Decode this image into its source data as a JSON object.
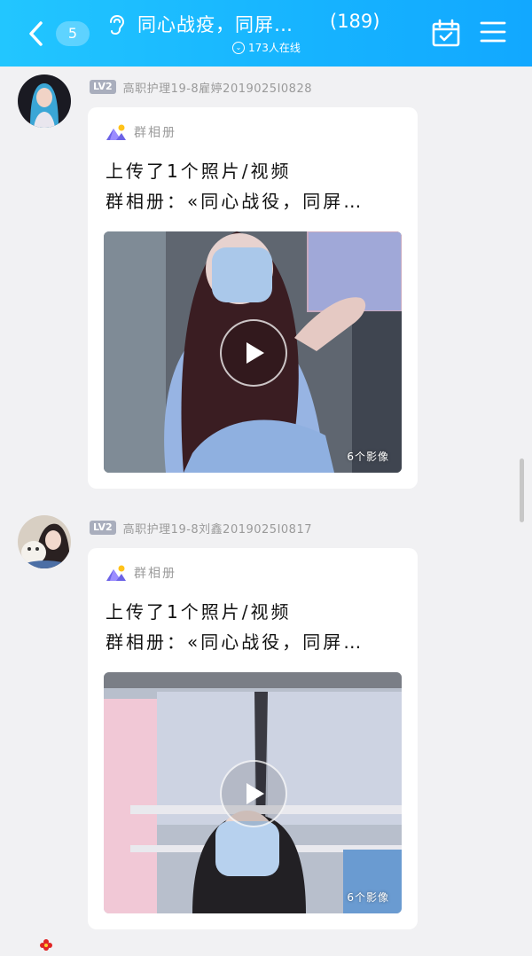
{
  "header": {
    "unread_count": "5",
    "title": "同心战疫，同屏…",
    "member_count": "(189)",
    "online_status": "173人在线",
    "colors": {
      "bar": "#16b3ff",
      "text": "#ffffff"
    }
  },
  "messages": [
    {
      "level": "LV2",
      "sender": "高职护理19-8雇婷2019025I0828",
      "source_label": "群相册",
      "line1": "上传了1个照片/视频",
      "line2": "群相册：«同心战役，同屏…",
      "media_count": "6个影像"
    },
    {
      "level": "LV2",
      "sender": "高职护理19-8刘鑫2019025I0817",
      "source_label": "群相册",
      "line1": "上传了1个照片/视频",
      "line2": "群相册：«同心战役，同屏…",
      "media_count": "6个影像"
    }
  ]
}
